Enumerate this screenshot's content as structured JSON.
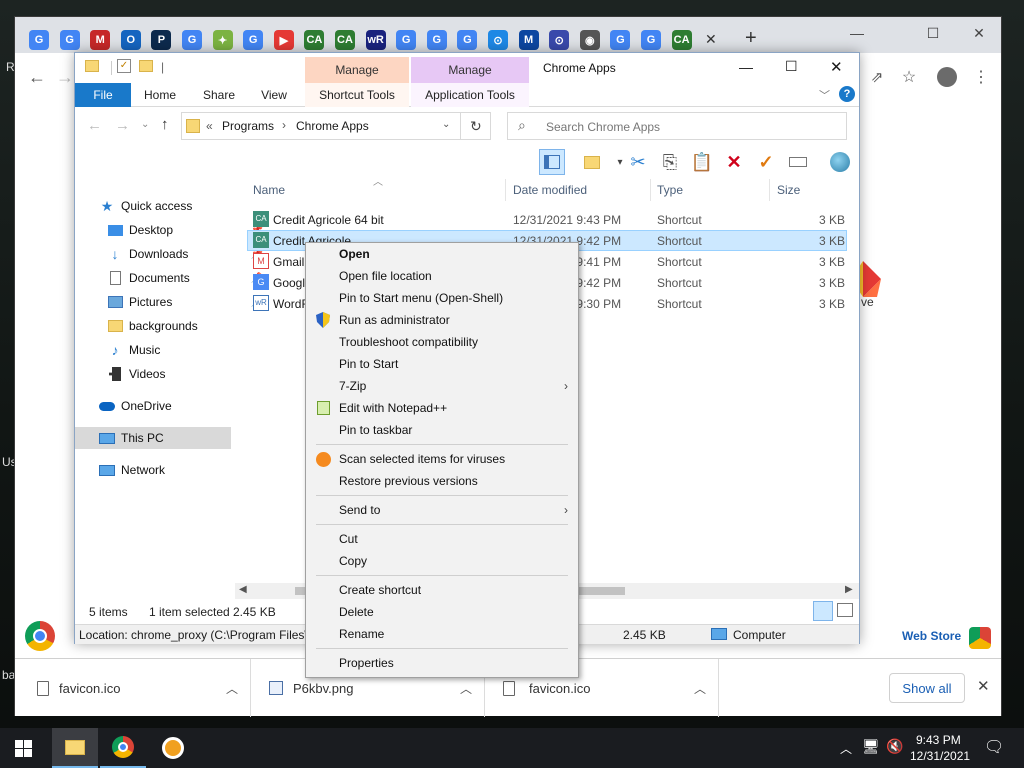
{
  "desktop": {
    "label_left_top": "R",
    "label_left_mid": "Us",
    "label_left_bottom": "ba",
    "label_right": "ve"
  },
  "chrome": {
    "tabs": [
      "G",
      "G",
      "M",
      "O",
      "P",
      "G",
      "✦",
      "G",
      "▶",
      "CA",
      "CA",
      "wR",
      "G",
      "G",
      "G",
      "⊙",
      "M",
      "⊙",
      "◉",
      "G",
      "G",
      "CA"
    ],
    "web_store": "Web Store",
    "downloads": [
      {
        "name": "favicon.ico"
      },
      {
        "name": "P6kbv.png"
      },
      {
        "name": "favicon.ico"
      }
    ],
    "show_all": "Show all"
  },
  "explorer": {
    "title": "Chrome Apps",
    "ribbon": {
      "file": "File",
      "home": "Home",
      "share": "Share",
      "view": "View",
      "manage1": "Manage",
      "manage2": "Manage",
      "shortcut_tools": "Shortcut Tools",
      "application_tools": "Application Tools"
    },
    "address": {
      "chevrons": "«",
      "crumb1": "Programs",
      "sep": "›",
      "crumb2": "Chrome Apps"
    },
    "search_placeholder": "Search Chrome Apps",
    "nav": {
      "quick_access": "Quick access",
      "desktop": "Desktop",
      "downloads": "Downloads",
      "documents": "Documents",
      "pictures": "Pictures",
      "backgrounds": "backgrounds",
      "music": "Music",
      "videos": "Videos",
      "onedrive": "OneDrive",
      "this_pc": "This PC",
      "network": "Network"
    },
    "columns": {
      "name": "Name",
      "date": "Date modified",
      "type": "Type",
      "size": "Size"
    },
    "files": [
      {
        "name": "Credit Agricole 64 bit",
        "date": "12/31/2021 9:43 PM",
        "type": "Shortcut",
        "size": "3 KB"
      },
      {
        "name": "Credit Agricole",
        "date": "12/31/2021 9:42 PM",
        "type": "Shortcut",
        "size": "3 KB"
      },
      {
        "name": "Gmail",
        "date": "12/31/2021 9:41 PM",
        "type": "Shortcut",
        "size": "3 KB"
      },
      {
        "name": "Google Translate",
        "date": "12/31/2021 9:42 PM",
        "type": "Shortcut",
        "size": "3 KB"
      },
      {
        "name": "WordReference Translator",
        "date": "12/31/2021 9:30 PM",
        "type": "Shortcut",
        "size": "3 KB"
      }
    ],
    "status": {
      "items": "5 items",
      "selected": "1 item selected",
      "size": "2.45 KB"
    },
    "details": {
      "location": "Location: chrome_proxy (C:\\Program Files\\",
      "size": "2.45 KB",
      "computer": "Computer"
    }
  },
  "context_menu": {
    "open": "Open",
    "open_location": "Open file location",
    "pin_start_shell": "Pin to Start menu (Open-Shell)",
    "run_admin": "Run as administrator",
    "troubleshoot": "Troubleshoot compatibility",
    "pin_start": "Pin to Start",
    "zip": "7-Zip",
    "notepad": "Edit with Notepad++",
    "pin_taskbar": "Pin to taskbar",
    "scan": "Scan selected items for viruses",
    "restore": "Restore previous versions",
    "send_to": "Send to",
    "cut": "Cut",
    "copy": "Copy",
    "create_shortcut": "Create shortcut",
    "delete": "Delete",
    "rename": "Rename",
    "properties": "Properties"
  },
  "taskbar": {
    "time": "9:43 PM",
    "date": "12/31/2021"
  }
}
